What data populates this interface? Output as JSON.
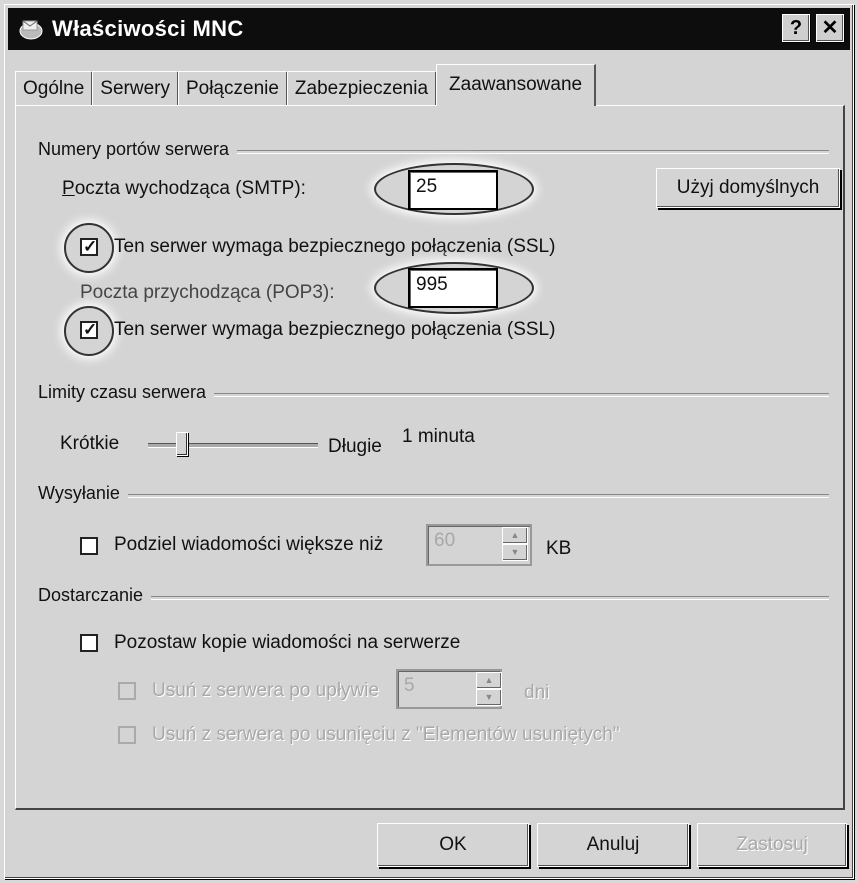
{
  "window": {
    "title": "Właściwości MNC",
    "help_label": "?",
    "close_label": "✕"
  },
  "tabs": [
    {
      "label": "Ogólne"
    },
    {
      "label": "Serwery"
    },
    {
      "label": "Połączenie"
    },
    {
      "label": "Zabezpieczenia"
    },
    {
      "label": "Zaawansowane",
      "active": true
    }
  ],
  "ports": {
    "group_label": "Numery portów serwera",
    "smtp_label": "Poczta wychodząca (SMTP):",
    "smtp_value": "25",
    "smtp_ssl_label": "Ten serwer wymaga bezpiecznego połączenia (SSL)",
    "smtp_ssl_checked": true,
    "pop3_label": "Poczta przychodząca (POP3):",
    "pop3_value": "995",
    "pop3_ssl_label": "Ten serwer wymaga bezpiecznego połączenia (SSL)",
    "pop3_ssl_checked": true,
    "defaults_button": "Użyj domyślnych"
  },
  "timeouts": {
    "group_label": "Limity czasu serwera",
    "short_label": "Krótkie",
    "long_label": "Długie",
    "value_label": "1 minuta",
    "slider_level": 0.2
  },
  "sending": {
    "group_label": "Wysyłanie",
    "split_label": "Podziel wiadomości większe niż",
    "split_checked": false,
    "split_value": "60",
    "unit": "KB"
  },
  "delivery": {
    "group_label": "Dostarczanie",
    "keep_copies_label": "Pozostaw kopie wiadomości na serwerze",
    "keep_copies_checked": false,
    "remove_after_label": "Usuń z serwera po upływie",
    "remove_after_value": "5",
    "days_unit": "dni",
    "remove_deleted_label": "Usuń z serwera po usunięciu z \"Elementów usuniętych\""
  },
  "footer": {
    "ok": "OK",
    "cancel": "Anuluj",
    "apply": "Zastosuj"
  },
  "colors": {
    "titlebar": "#0d0d0d",
    "face": "#d4d4d4",
    "highlight_oval": "#ffffff"
  },
  "icons": {
    "window_icon": "envelope-globe-icon",
    "help": "help-icon",
    "close": "close-icon",
    "spin_up": "chevron-up-icon",
    "spin_down": "chevron-down-icon"
  }
}
